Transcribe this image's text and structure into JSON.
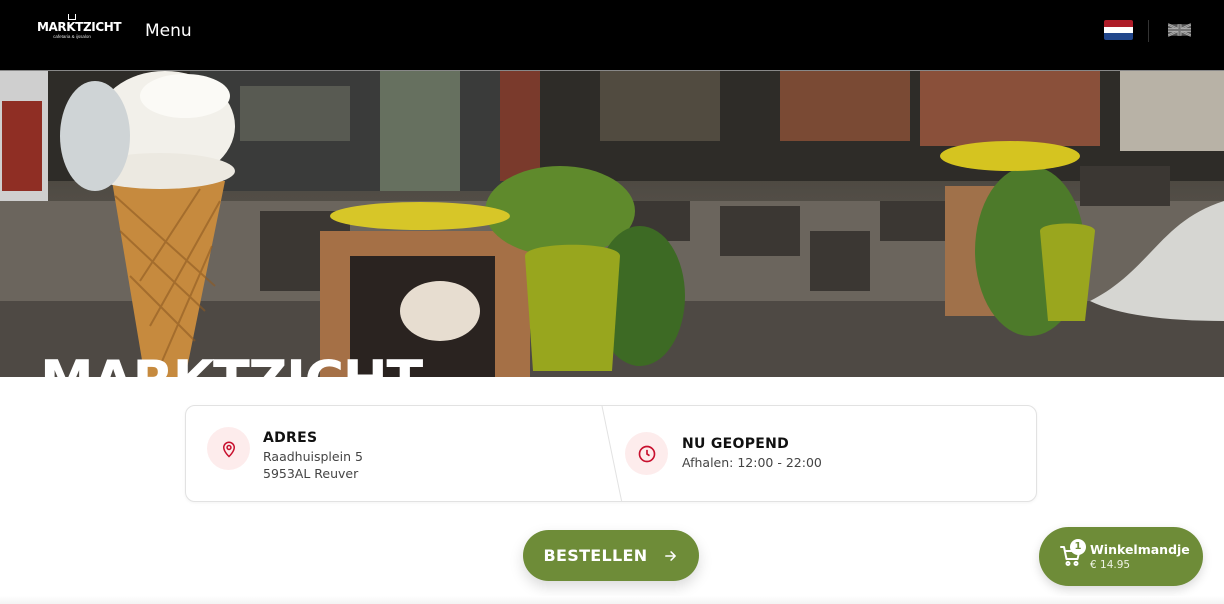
{
  "header": {
    "logo": {
      "wordmark": "MARKTZICHT",
      "tagline": "cafetaria & ijssalon"
    },
    "menu_label": "Menu",
    "languages": [
      {
        "code": "nl",
        "icon": "netherlands-flag-icon",
        "colors": [
          "#ae1c28",
          "#ffffff",
          "#21468b"
        ]
      },
      {
        "code": "en",
        "icon": "united-kingdom-flag-icon"
      }
    ]
  },
  "hero": {
    "title": "MARKTZICHT"
  },
  "info": {
    "address": {
      "icon": "map-pin-icon",
      "heading": "ADRES",
      "line1": "Raadhuisplein 5",
      "line2": "5953AL Reuver"
    },
    "hours": {
      "icon": "clock-icon",
      "heading": "NU GEOPEND",
      "line1": "Afhalen: 12:00 - 22:00"
    }
  },
  "actions": {
    "order_label": "BESTELLEN",
    "order_icon": "arrow-right-icon"
  },
  "cart": {
    "icon": "shopping-cart-icon",
    "count": "1",
    "label": "Winkelmandje",
    "total": "€ 14.95"
  },
  "colors": {
    "accent": "#6e8c38",
    "icon_red": "#c8102e",
    "icon_bg": "#fdecec",
    "header_bg": "#000000"
  }
}
